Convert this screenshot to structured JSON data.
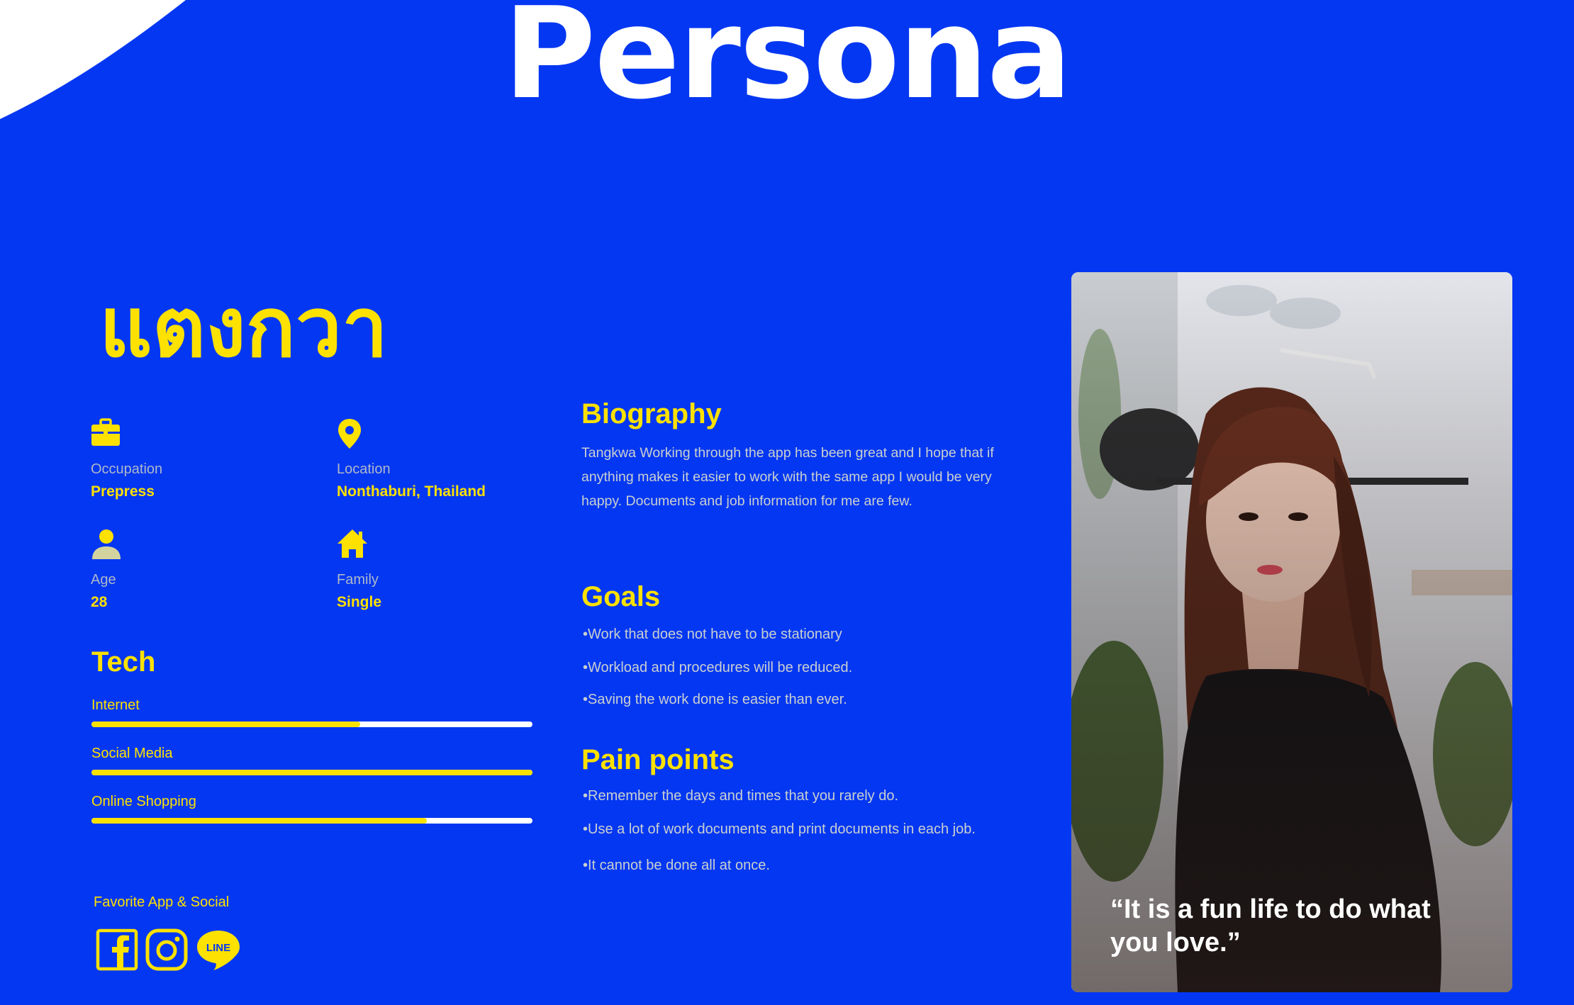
{
  "page_title": "Persona",
  "persona": {
    "name": "แตงกวา",
    "quote": "“It is a fun life to do what you love.”"
  },
  "attributes": [
    {
      "icon": "briefcase-icon",
      "label": "Occupation",
      "value": "Prepress"
    },
    {
      "icon": "location-pin-icon",
      "label": "Location",
      "value": "Nonthaburi, Thailand"
    },
    {
      "icon": "person-icon",
      "label": "Age",
      "value": "28"
    },
    {
      "icon": "house-icon",
      "label": "Family",
      "value": "Single"
    }
  ],
  "tech": {
    "heading": "Tech",
    "items": [
      {
        "label": "Internet",
        "level": 0.61
      },
      {
        "label": "Social Media",
        "level": 1.0
      },
      {
        "label": "Online Shopping",
        "level": 0.76
      }
    ]
  },
  "favorites": {
    "label": "Favorite App & Social",
    "apps": [
      "facebook-icon",
      "instagram-icon",
      "line-icon"
    ],
    "line_text": "LINE"
  },
  "biography": {
    "heading": "Biography",
    "text": "Tangkwa Working through the app has been great and I hope that if anything makes it easier to work with the same app I would be very happy. Documents and job information for me are few."
  },
  "goals": {
    "heading": "Goals",
    "items": [
      "Work that does not have to be stationary",
      "Workload and procedures will be reduced.",
      "Saving the work done is easier than ever."
    ]
  },
  "pain_points": {
    "heading": "Pain points",
    "items": [
      "Remember the days and times that you rarely do.",
      "Use a lot of work documents and print documents in each job.",
      "It cannot be done all at once."
    ]
  },
  "colors": {
    "background": "#0437f2",
    "accent": "#fde100",
    "title": "#ffffff",
    "body_text": "#cad0cf",
    "label_text": "#aeb8c8"
  }
}
